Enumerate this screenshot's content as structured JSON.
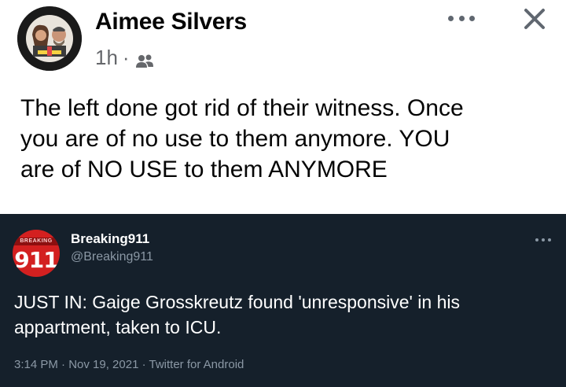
{
  "post": {
    "author": "Aimee Silvers",
    "time": "1h",
    "separator": "·",
    "audience_icon": "friends-icon",
    "text": "The left done got rid of their witness. Once\nyou are of no use to them anymore. YOU\nare of NO USE to them ANYMORE",
    "more_icon": "more-horizontal-icon",
    "close_icon": "close-icon"
  },
  "tweet": {
    "logo_band": "BREAKING",
    "logo_number": "911",
    "name": "Breaking911",
    "handle": "@Breaking911",
    "text": "JUST IN: Gaige Grosskreutz found 'unresponsive' in his\nappartment, taken to ICU.",
    "meta": "3:14 PM · Nov 19, 2021 · Twitter for Android",
    "more_icon": "more-horizontal-icon"
  },
  "colors": {
    "tweet_background": "#15202b",
    "secondary_text": "#65676b",
    "tweet_secondary_text": "#8b98a5",
    "logo_red": "#d32020"
  }
}
